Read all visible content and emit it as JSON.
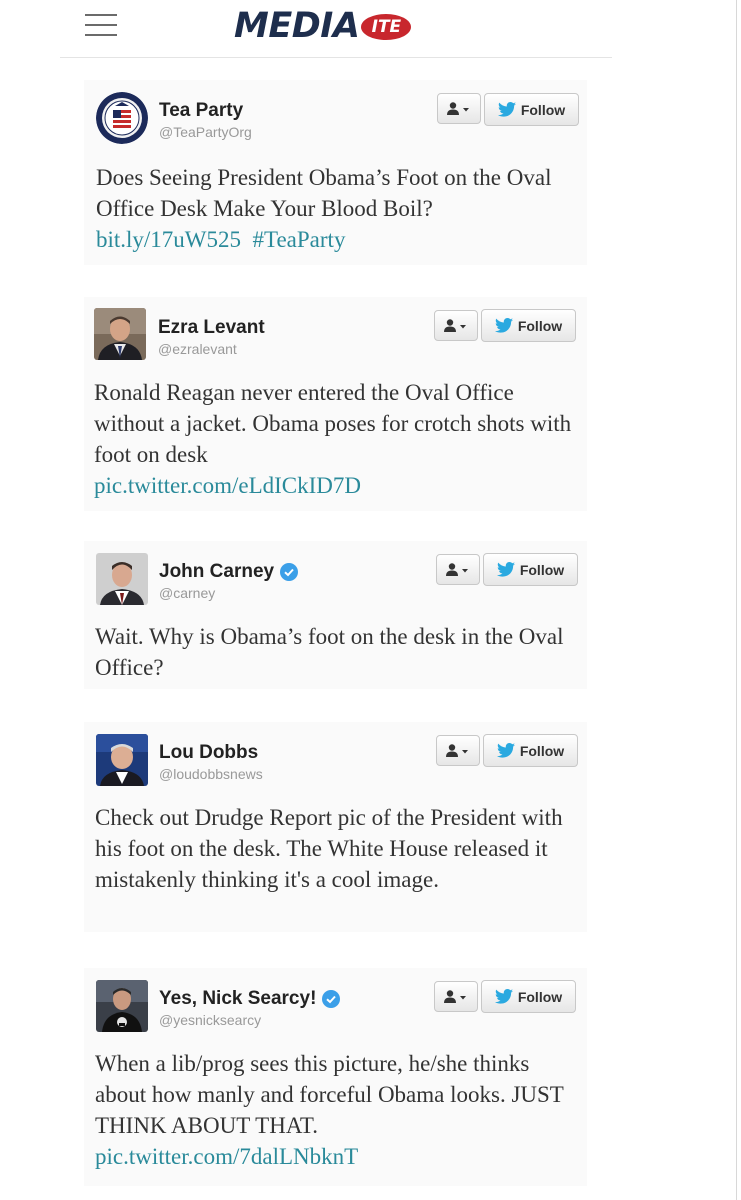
{
  "header": {
    "logo_main": "MEDIA",
    "logo_badge": "ITE"
  },
  "colors": {
    "link": "#2a8a9a",
    "twitter_blue": "#2aa9e0",
    "logo_navy": "#1e2e4d",
    "logo_red": "#c8272d"
  },
  "tweets": [
    {
      "name": "Tea Party",
      "handle": "@TeaPartyOrg",
      "verified": false,
      "follow_label": "Follow",
      "text": "Does Seeing President Obama’s Foot on the Oval Office Desk Make Your Blood Boil?",
      "links": [
        "bit.ly/17uW525",
        "#TeaParty"
      ]
    },
    {
      "name": "Ezra Levant",
      "handle": "@ezralevant",
      "verified": false,
      "follow_label": "Follow",
      "text": "Ronald Reagan never entered the Oval Office without a jacket. Obama poses for crotch shots with foot on desk",
      "links": [
        "pic.twitter.com/eLdICkID7D"
      ]
    },
    {
      "name": "John Carney",
      "handle": "@carney",
      "verified": true,
      "follow_label": "Follow",
      "text": "Wait. Why is Obama’s foot on the desk in the Oval Office?",
      "links": []
    },
    {
      "name": "Lou Dobbs",
      "handle": "@loudobbsnews",
      "verified": false,
      "follow_label": "Follow",
      "text": "Check out Drudge Report pic of the President with his foot on the desk. The White House released it mistakenly thinking it's a cool image.",
      "links": []
    },
    {
      "name": "Yes, Nick Searcy!",
      "handle": "@yesnicksearcy",
      "verified": true,
      "follow_label": "Follow",
      "text": "When a lib/prog sees this picture, he/she thinks about how manly and forceful Obama looks. JUST THINK ABOUT THAT.",
      "links": [
        "pic.twitter.com/7dalLNbknT"
      ]
    }
  ]
}
